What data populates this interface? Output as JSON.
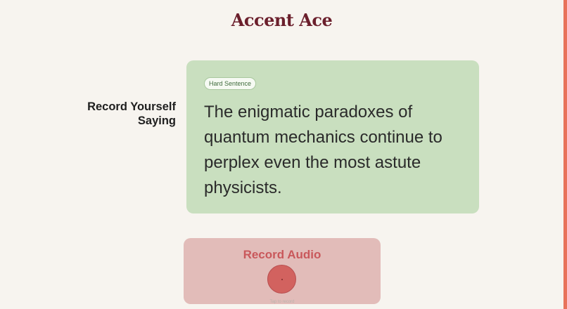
{
  "app": {
    "title": "Accent Ace"
  },
  "prompt": {
    "label": "Record Yourself Saying"
  },
  "sentence": {
    "difficulty": "Hard Sentence",
    "text": "The enigmatic paradoxes of quantum mechanics continue to perplex even the most astute physicists."
  },
  "recorder": {
    "title": "Record Audio",
    "hint": "Tap to record"
  },
  "colors": {
    "background": "#f7f4ef",
    "brand": "#6b1f2c",
    "card": "#c9dfbf",
    "record_panel": "#e2bcb9",
    "record_button": "#d2625f",
    "accent_edge": "#e8735b"
  },
  "icons": {
    "record": "microphone-icon"
  }
}
